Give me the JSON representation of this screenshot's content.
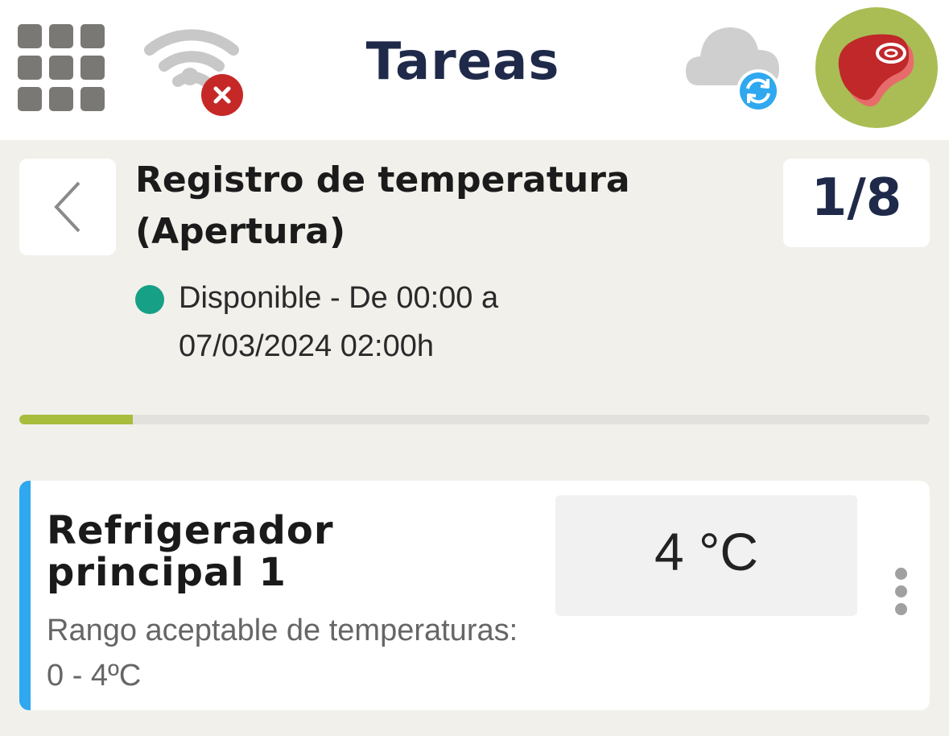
{
  "header": {
    "title": "Tareas",
    "apps_icon": "grid-icon",
    "wifi_icon": "wifi-off-icon",
    "sync_icon": "cloud-sync-icon",
    "avatar_icon": "meat-steak-icon",
    "colors": {
      "title": "#1f2a4a",
      "avatar_bg": "#a9bd54",
      "error": "#c62828",
      "sync": "#2fa8f0"
    }
  },
  "task": {
    "title": "Registro de temperatura (Apertura)",
    "counter": "1/8",
    "status_color": "#16a085",
    "status_text": "Disponible - De 00:00 a 07/03/2024 02:00h",
    "progress_fraction": 0.125,
    "progress_color": "#a9bd3d"
  },
  "card": {
    "accent_color": "#2fa8f0",
    "title": "Refrigerador principal 1",
    "description": "Rango aceptable de temperaturas: 0 - 4ºC",
    "value": "4 °C"
  }
}
